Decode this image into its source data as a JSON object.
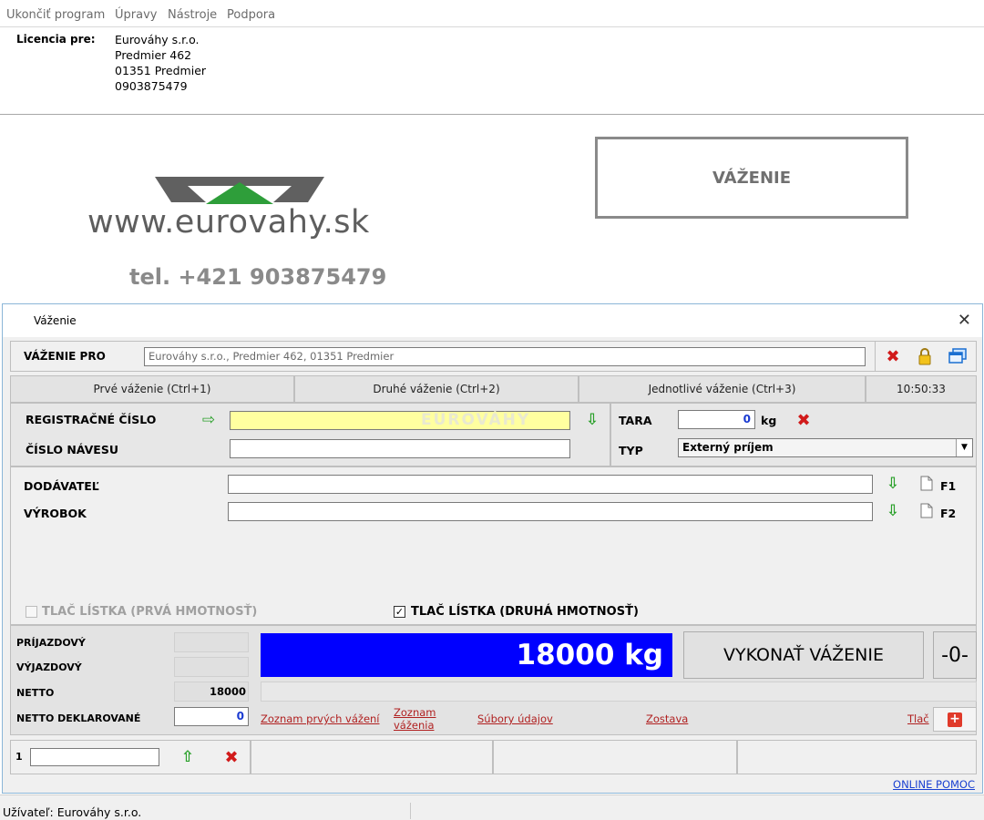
{
  "menu": {
    "items": [
      "Ukončiť program",
      "Úpravy",
      "Nástroje",
      "Podpora"
    ]
  },
  "license": {
    "label": "Licencia pre:",
    "lines": [
      "Eurováhy s.r.o.",
      "Predmier  462",
      "01351 Predmier",
      "0903875479"
    ]
  },
  "logo": {
    "url_text": "www.eurovahy.sk",
    "phone_text": "tel. +421 903875479",
    "watermark": "EUROVÁHY"
  },
  "main_button": {
    "label": "VÁŽENIE"
  },
  "dialog": {
    "title": "Váženie",
    "vazenie_pro_label": "VÁŽENIE PRO",
    "vazenie_pro_value": "Eurováhy s.r.o., Predmier  462, 01351 Predmier",
    "tabs": [
      "Prvé váženie (Ctrl+1)",
      "Druhé váženie (Ctrl+2)",
      "Jednotlivé váženie (Ctrl+3)"
    ],
    "clock": "10:50:33",
    "reg_cislo_label": "REGISTRAČNÉ ČÍSLO",
    "reg_cislo_value": "",
    "cislo_navesu_label": "ČÍSLO NÁVESU",
    "cislo_navesu_value": "",
    "tara_label": "TARA",
    "tara_value": "0",
    "tara_unit": "kg",
    "typ_label": "TYP",
    "typ_value": "Externý príjem",
    "dodavatel_label": "DODÁVATEĽ",
    "dodavatel_value": "",
    "dodavatel_key": "F1",
    "vyrobok_label": "VÝROBOK",
    "vyrobok_value": "",
    "vyrobok_key": "F2",
    "print_first_label": "TLAČ LÍSTKA (PRVÁ HMOTNOSŤ)",
    "print_first_checked": false,
    "print_second_label": "TLAČ LÍSTKA (DRUHÁ HMOTNOSŤ)",
    "print_second_checked": true,
    "prijazdovy_label": "PRÍJAZDOVÝ",
    "vyjazdovy_label": "VÝJAZDOVÝ",
    "netto_label": "NETTO",
    "netto_value": "18000",
    "netto_dekl_label": "NETTO DEKLAROVANÉ",
    "netto_dekl_value": "0",
    "weight_display": "18000 kg",
    "vykonat_label": "VYKONAŤ VÁŽENIE",
    "zero_label": "-0-",
    "links": {
      "zoznam_prvych": "Zoznam prvých vážení",
      "zoznam_vazenia_1": "Zoznam",
      "zoznam_vazenia_2": "váženia",
      "subory": "Súbory údajov",
      "zostava": "Zostava",
      "tlac": "Tlač"
    },
    "counter_label": "1",
    "counter_value": "",
    "online_help": "ONLINE POMOC"
  },
  "statusbar": {
    "user": "Užívateľ: Eurováhy s.r.o."
  },
  "colors": {
    "weight_bg": "#0000ff",
    "highlight_input": "#ffffa0",
    "red_link": "#b02020",
    "green_arrow": "#2aa02a",
    "red_x": "#d11a1a"
  }
}
